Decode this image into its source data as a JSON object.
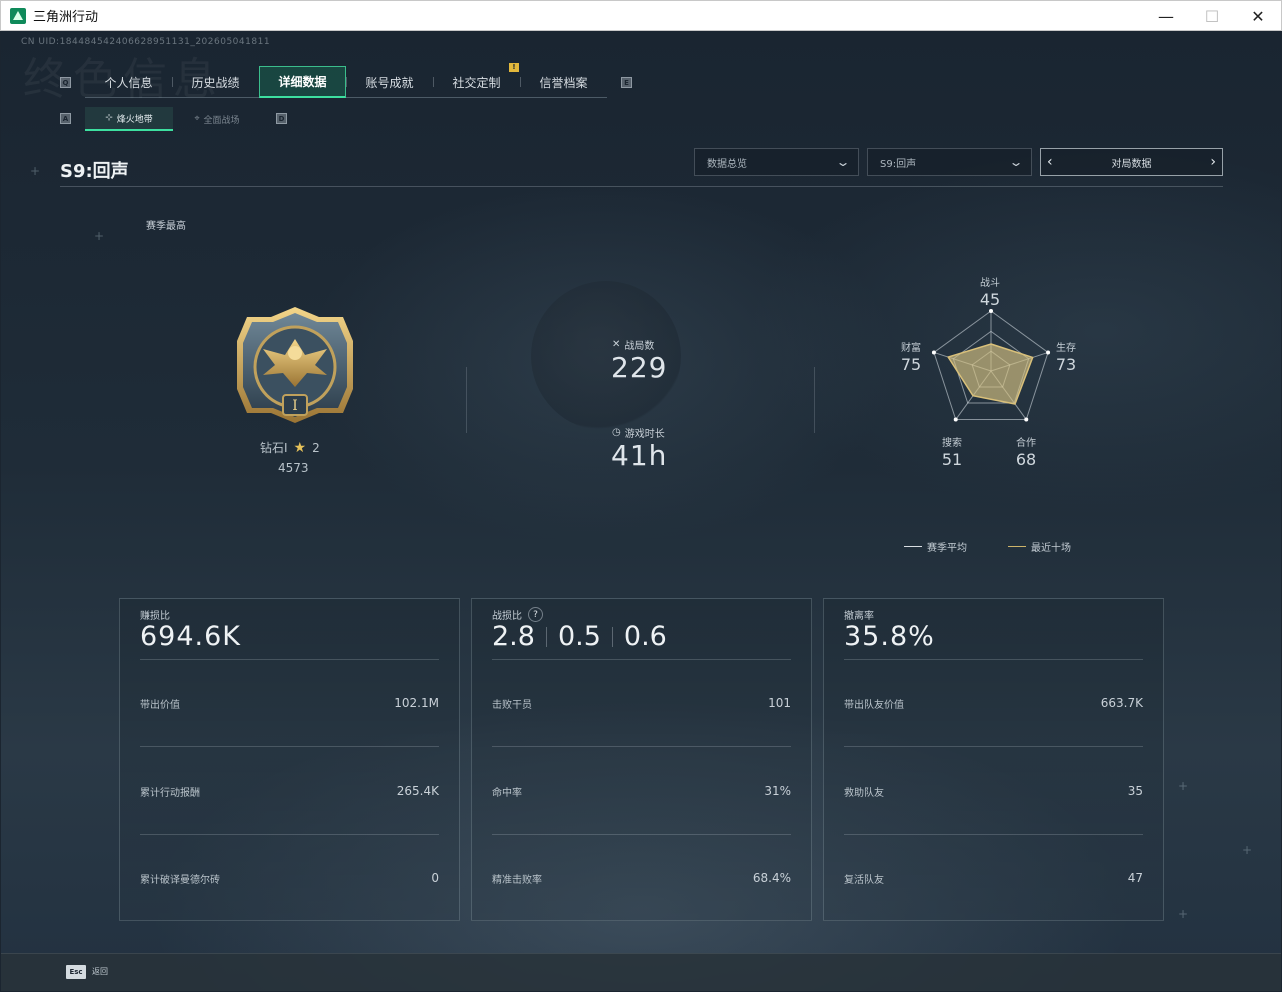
{
  "window": {
    "title": "三角洲行动",
    "minimize": "—",
    "maximize": "☐",
    "close": "✕"
  },
  "uid": "CN UID:1844845424066289511­31_202605041811",
  "watermark_title": "终色信息",
  "key_hints": {
    "tab_prev": "Q",
    "tab_next": "E",
    "sub_prev": "A",
    "sub_next": "D"
  },
  "tabs": [
    {
      "label": "个人信息"
    },
    {
      "label": "历史战绩"
    },
    {
      "label": "详细数据",
      "active": true
    },
    {
      "label": "账号成就"
    },
    {
      "label": "社交定制"
    },
    {
      "label": "信誉档案"
    }
  ],
  "tab_badge": "!",
  "subtabs": [
    {
      "label": "烽火地带",
      "icon": "compass-icon",
      "active": true
    },
    {
      "label": "全面战场",
      "icon": "crosshair-icon"
    }
  ],
  "season_title": "S9:回声",
  "filters": {
    "view": "数据总览",
    "season": "S9:回声",
    "pager_label": "对局数据",
    "prev": "‹",
    "next": "›"
  },
  "season_best": {
    "label": "赛季最高",
    "rank_name": "钻石I",
    "stars": "2",
    "score": "4573"
  },
  "summary": {
    "matches_label": "战局数",
    "matches_value": "229",
    "playtime_label": "游戏时长",
    "playtime_value": "41h"
  },
  "radar": {
    "axes": [
      {
        "label": "战斗",
        "value": "45"
      },
      {
        "label": "生存",
        "value": "73"
      },
      {
        "label": "合作",
        "value": "68"
      },
      {
        "label": "搜索",
        "value": "51"
      },
      {
        "label": "财富",
        "value": "75"
      }
    ],
    "legend": [
      {
        "label": "赛季平均",
        "color": "#d9dee2"
      },
      {
        "label": "最近十场",
        "color": "#cdb46a"
      }
    ]
  },
  "cards": [
    {
      "label": "赚损比",
      "big": "694.6K",
      "rows": [
        {
          "label": "带出价值",
          "value": "102.1M"
        },
        {
          "label": "累计行动报酬",
          "value": "265.4K"
        },
        {
          "label": "累计破译曼德尔砖",
          "value": "0"
        }
      ]
    },
    {
      "label": "战损比",
      "help": "?",
      "triple": [
        "2.8",
        "0.5",
        "0.6"
      ],
      "rows": [
        {
          "label": "击败干员",
          "value": "101"
        },
        {
          "label": "命中率",
          "value": "31%"
        },
        {
          "label": "精准击败率",
          "value": "68.4%"
        }
      ]
    },
    {
      "label": "撤离率",
      "big": "35.8%",
      "rows": [
        {
          "label": "带出队友价值",
          "value": "663.7K"
        },
        {
          "label": "救助队友",
          "value": "35"
        },
        {
          "label": "复活队友",
          "value": "47"
        }
      ]
    }
  ],
  "footer": {
    "key": "Esc",
    "label": "返回"
  }
}
